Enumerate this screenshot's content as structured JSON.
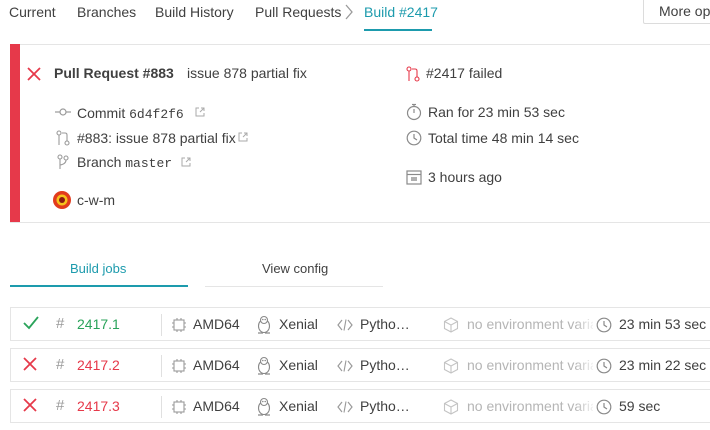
{
  "nav": {
    "tabs": [
      "Current",
      "Branches",
      "Build History",
      "Pull Requests"
    ],
    "active_tab": "Build #2417",
    "more_label": "More opt"
  },
  "build": {
    "title": "Pull Request #883",
    "message": "issue 878 partial fix",
    "commit_label": "Commit",
    "commit_sha": "6d4f2f6",
    "pr_label": "#883: issue 878 partial fix",
    "branch_label": "Branch",
    "branch_name": "master",
    "author": "c-w-m",
    "status": "#2417 failed",
    "ran_for": "Ran for 23 min 53 sec",
    "total_time": "Total time 48 min 14 sec",
    "finished": "3 hours ago"
  },
  "tabs": {
    "jobs": "Build jobs",
    "config": "View config"
  },
  "jobs": [
    {
      "status": "passed",
      "number": "2417.1",
      "arch": "AMD64",
      "os": "Xenial",
      "language": "Pytho…",
      "env": "no environment variables set",
      "duration": "23 min 53 sec"
    },
    {
      "status": "failed",
      "number": "2417.2",
      "arch": "AMD64",
      "os": "Xenial",
      "language": "Pytho…",
      "env": "no environment variables set",
      "duration": "23 min 22 sec"
    },
    {
      "status": "failed",
      "number": "2417.3",
      "arch": "AMD64",
      "os": "Xenial",
      "language": "Pytho…",
      "env": "no environment variables set",
      "duration": "59 sec"
    }
  ],
  "colors": {
    "accent": "#1d9bad",
    "failed": "#e6394a",
    "passed": "#2aa35a"
  }
}
